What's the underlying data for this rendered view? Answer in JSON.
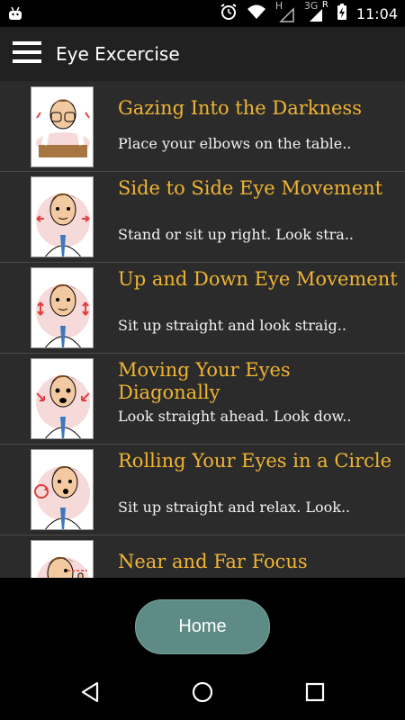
{
  "status_bar": {
    "time": "11:04",
    "network_h": "H",
    "network_3g": "3G",
    "roaming": "R",
    "icons": [
      "android-debug-icon",
      "alarm-icon",
      "wifi-icon",
      "signal-icon",
      "battery-charging-icon"
    ]
  },
  "app_bar": {
    "title": "Eye Excercise",
    "menu_icon": "hamburger-menu-icon"
  },
  "exercises": [
    {
      "title": "Gazing Into the Darkness",
      "description": "Place your elbows on the table.."
    },
    {
      "title": "Side to Side Eye Movement",
      "description": "Stand or sit up right. Look stra.."
    },
    {
      "title": "Up and Down Eye Movement",
      "description": "Sit up straight and look straig.."
    },
    {
      "title": "Moving Your Eyes Diagonally",
      "description": "Look straight ahead. Look dow.."
    },
    {
      "title": "Rolling Your Eyes in a Circle",
      "description": "Sit up straight and relax. Look.."
    },
    {
      "title": "Near and Far Focus",
      "description": ""
    }
  ],
  "home_button": {
    "label": "Home"
  },
  "nav_bar": {
    "icons": [
      "back-icon",
      "home-circle-icon",
      "recents-icon"
    ]
  },
  "colors": {
    "title_accent": "#f0b432",
    "list_background": "#2b2b2b",
    "app_bar": "#212121",
    "home_button": "#5e8b86"
  }
}
